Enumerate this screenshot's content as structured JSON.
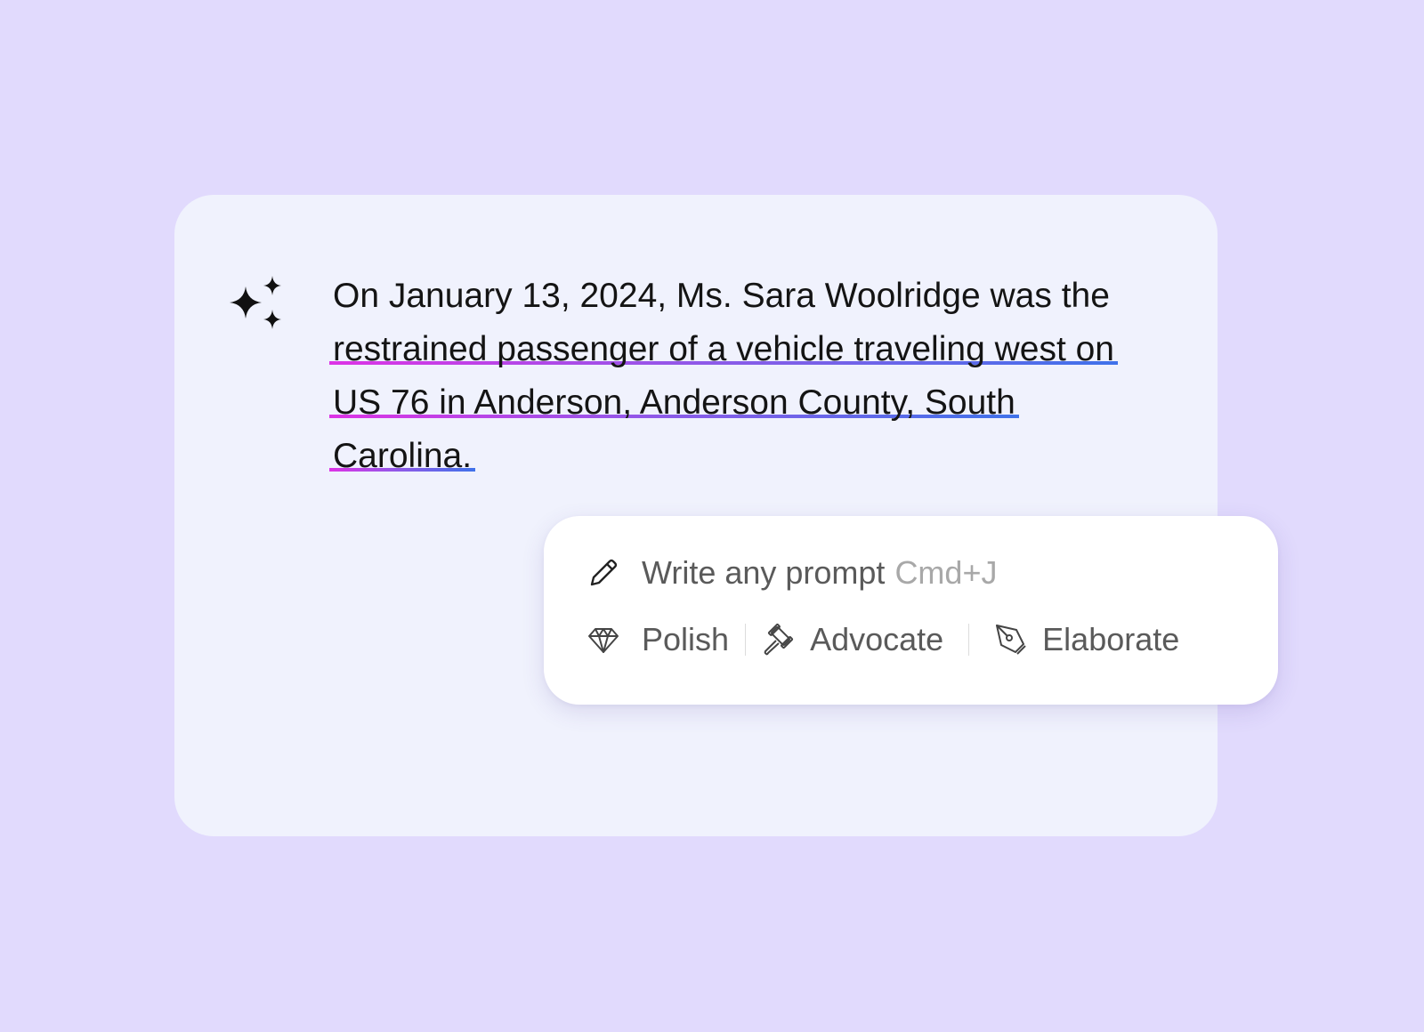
{
  "editor": {
    "text_before": "On January 13, 2024, Ms. Sara Woolridge was the ",
    "text_highlighted": "restrained passenger of a vehicle traveling west on US 76 in Anderson, Anderson County, South Carolina.",
    "highlight_gradient": [
      "#dd33e6",
      "#8a5be8",
      "#3f72ea"
    ]
  },
  "popup": {
    "prompt_placeholder": "Write any prompt",
    "prompt_shortcut": "Cmd+J",
    "actions": [
      {
        "label": "Polish",
        "icon": "diamond-icon"
      },
      {
        "label": "Advocate",
        "icon": "gavel-icon"
      },
      {
        "label": "Elaborate",
        "icon": "pen-nib-icon"
      }
    ]
  },
  "colors": {
    "background": "#e1dafd",
    "card": "#f0f2fd",
    "popup": "#ffffff"
  },
  "icons": {
    "ai": "sparkles-icon",
    "prompt": "pencil-icon"
  }
}
